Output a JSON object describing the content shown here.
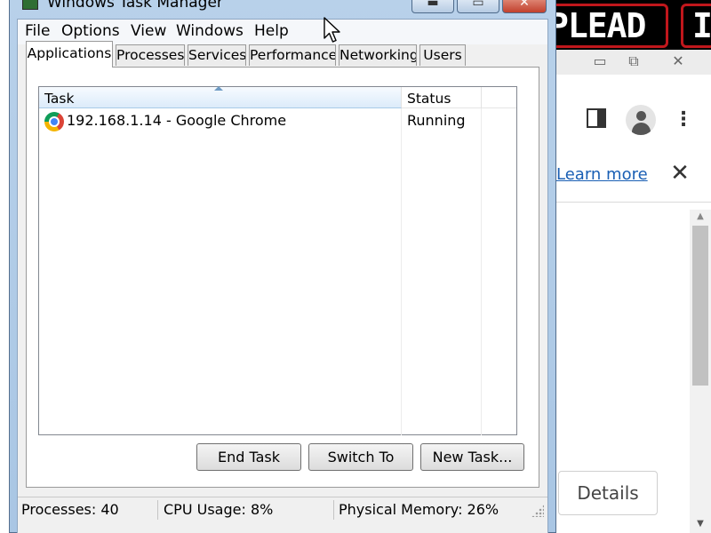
{
  "background_browser": {
    "banner_text_1": "PLEAD",
    "banner_text_2": "I",
    "learn_more_link": "Learn more",
    "close_glyph": "✕",
    "details_button": "Details",
    "minimize_glyph": "▭",
    "restore_glyph": "⧉",
    "close_window_glyph": "✕",
    "menu_glyph": "⋮",
    "scroll_up_glyph": "▲",
    "scroll_down_glyph": "▼"
  },
  "task_manager": {
    "title": "Windows Task Manager",
    "controls": {
      "minimize": "▬",
      "maximize": "▭",
      "close": "✕"
    },
    "menu": [
      "File",
      "Options",
      "View",
      "Windows",
      "Help"
    ],
    "tabs": [
      "Applications",
      "Processes",
      "Services",
      "Performance",
      "Networking",
      "Users"
    ],
    "active_tab": "Applications",
    "columns": {
      "task": "Task",
      "status": "Status"
    },
    "rows": [
      {
        "task": "192.168.1.14 - Google Chrome",
        "status": "Running",
        "icon": "chrome-icon"
      }
    ],
    "buttons": {
      "end_task": "End Task",
      "switch_to": "Switch To",
      "new_task": "New Task..."
    },
    "status_bar": {
      "processes": "Processes: 40",
      "cpu": "CPU Usage: 8%",
      "memory": "Physical Memory: 26%"
    }
  },
  "colors": {
    "titlebar_blue": "#b8d1ea",
    "close_red": "#c2402d",
    "link_blue": "#1a5fb4",
    "banner_red": "#c0171c"
  }
}
